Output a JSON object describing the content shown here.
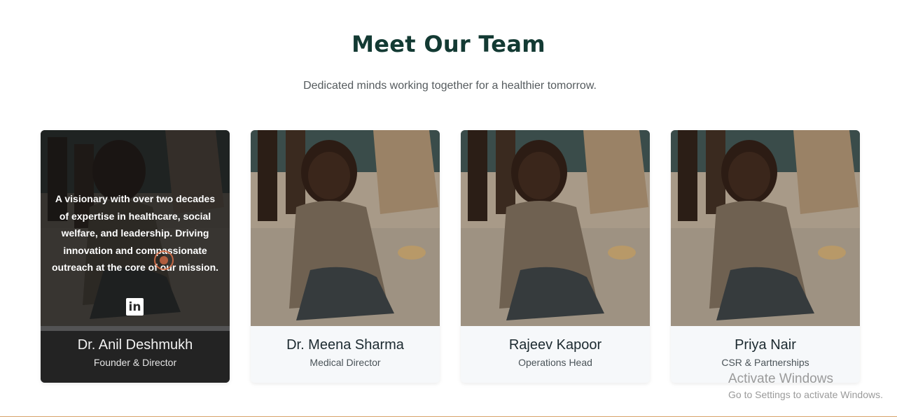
{
  "section": {
    "title": "Meet Our Team",
    "subtitle": "Dedicated minds working together for a healthier tomorrow."
  },
  "team": [
    {
      "name": "Dr. Anil Deshmukh",
      "role": "Founder & Director",
      "bio": "A visionary with over two decades of expertise in healthcare, social welfare, and leadership. Driving innovation and compassionate outreach at the core of our mission.",
      "social": "in"
    },
    {
      "name": "Dr. Meena Sharma",
      "role": "Medical Director"
    },
    {
      "name": "Rajeev Kapoor",
      "role": "Operations Head"
    },
    {
      "name": "Priya Nair",
      "role": "CSR & Partnerships"
    }
  ],
  "watermark": {
    "line1": "Activate Windows",
    "line2": "Go to Settings to activate Windows."
  },
  "colors": {
    "heading": "#133a33",
    "accent_line": "#d6a36a",
    "card_bg": "#f6f8fa"
  }
}
